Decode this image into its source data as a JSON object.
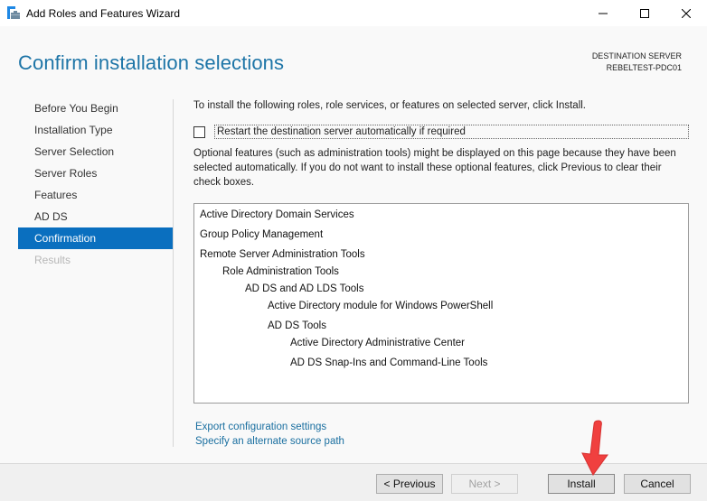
{
  "window": {
    "title": "Add Roles and Features Wizard",
    "icons": {
      "app": "server-manager-icon",
      "minimize": "minimize-icon",
      "maximize": "maximize-icon",
      "close": "close-icon"
    }
  },
  "header": {
    "page_title": "Confirm installation selections",
    "destination_label": "DESTINATION SERVER",
    "destination_value": "REBELTEST-PDC01"
  },
  "sidebar": {
    "items": [
      {
        "label": "Before You Begin",
        "state": "normal"
      },
      {
        "label": "Installation Type",
        "state": "normal"
      },
      {
        "label": "Server Selection",
        "state": "normal"
      },
      {
        "label": "Server Roles",
        "state": "normal"
      },
      {
        "label": "Features",
        "state": "normal"
      },
      {
        "label": "AD DS",
        "state": "normal"
      },
      {
        "label": "Confirmation",
        "state": "active"
      },
      {
        "label": "Results",
        "state": "disabled"
      }
    ]
  },
  "content": {
    "intro": "To install the following roles, role services, or features on selected server, click Install.",
    "restart_checkbox": {
      "label": "Restart the destination server automatically if required",
      "checked": false
    },
    "optional_note": "Optional features (such as administration tools) might be displayed on this page because they have been selected automatically. If you do not want to install these optional features, click Previous to clear their check boxes.",
    "features": [
      {
        "label": "Active Directory Domain Services",
        "level": 0
      },
      {
        "label": "Group Policy Management",
        "level": 0
      },
      {
        "label": "Remote Server Administration Tools",
        "level": 0
      },
      {
        "label": "Role Administration Tools",
        "level": 1
      },
      {
        "label": "AD DS and AD LDS Tools",
        "level": 2
      },
      {
        "label": "Active Directory module for Windows PowerShell",
        "level": 3
      },
      {
        "label": "AD DS Tools",
        "level": 3
      },
      {
        "label": "Active Directory Administrative Center",
        "level": 4
      },
      {
        "label": "AD DS Snap-Ins and Command-Line Tools",
        "level": 4
      }
    ],
    "links": {
      "export": "Export configuration settings",
      "alternate_source": "Specify an alternate source path"
    }
  },
  "footer": {
    "previous": "< Previous",
    "next": "Next >",
    "install": "Install",
    "cancel": "Cancel"
  },
  "colors": {
    "accent": "#0a6fbf",
    "title": "#1e75a7",
    "link": "#1a6fa0",
    "annotation_arrow": "#f0403f"
  }
}
